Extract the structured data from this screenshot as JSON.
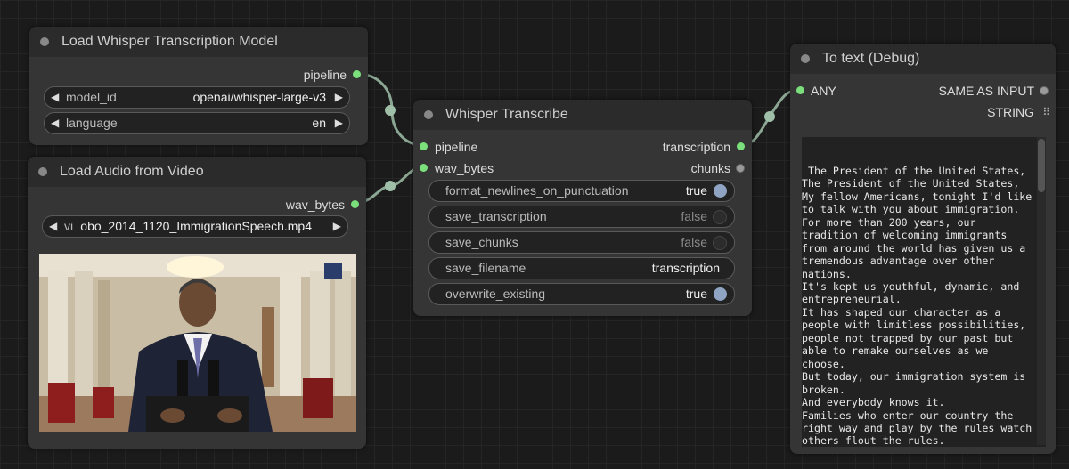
{
  "colors": {
    "link": "#9fbfa8",
    "pin_active": "#7be07b",
    "toggle_on": "#8fa3c2"
  },
  "node_load_model": {
    "title": "Load Whisper Transcription Model",
    "output_pipeline": "pipeline",
    "model_id_label": "model_id",
    "model_id_value": "openai/whisper-large-v3",
    "language_label": "language",
    "language_value": "en"
  },
  "node_load_audio": {
    "title": "Load Audio from Video",
    "output_wav": "wav_bytes",
    "video_label": "vi",
    "video_value": "obo_2014_1120_ImmigrationSpeech.mp4",
    "thumbnail_icon": "video-frame-speaker-at-podium"
  },
  "node_transcribe": {
    "title": "Whisper Transcribe",
    "input_pipeline": "pipeline",
    "input_wav": "wav_bytes",
    "output_transcription": "transcription",
    "output_chunks": "chunks",
    "widgets": [
      {
        "label": "format_newlines_on_punctuation",
        "value": "true",
        "on": true
      },
      {
        "label": "save_transcription",
        "value": "false",
        "on": false
      },
      {
        "label": "save_chunks",
        "value": "false",
        "on": false
      },
      {
        "label": "save_filename",
        "value": "transcription",
        "on": null
      },
      {
        "label": "overwrite_existing",
        "value": "true",
        "on": true
      }
    ]
  },
  "node_debug": {
    "title": "To text (Debug)",
    "input_any": "ANY",
    "output_same": "SAME AS INPUT",
    "output_string": "STRING",
    "text": " The President of the United States,\nThe President of the United States,\nMy fellow Americans, tonight I'd like to talk with you about immigration.\nFor more than 200 years, our tradition of welcoming immigrants from around the world has given us a tremendous advantage over other nations.\nIt's kept us youthful, dynamic, and entrepreneurial.\nIt has shaped our character as a people with limitless possibilities, people not trapped by our past but able to remake ourselves as we choose.\nBut today, our immigration system is broken.\nAnd everybody knows it.\nFamilies who enter our country the right way and play by the rules watch others flout the rules.\nBusiness owners who offer their workers good wages and benefits see"
  }
}
